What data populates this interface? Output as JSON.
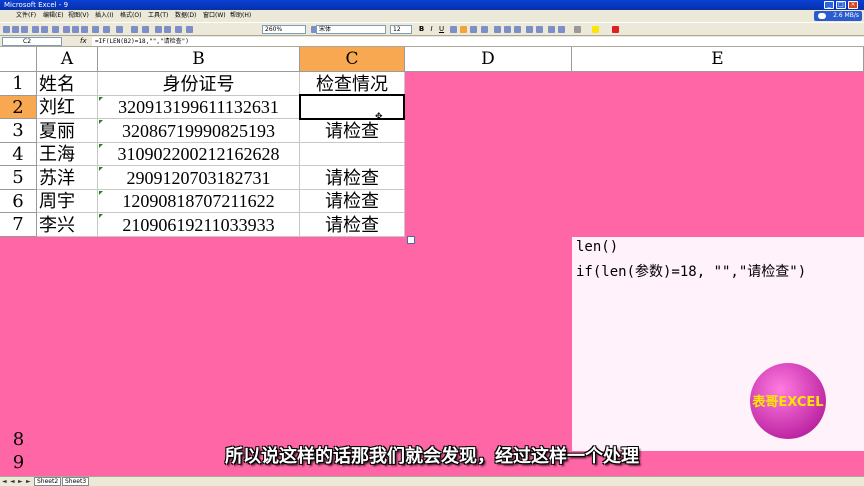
{
  "window": {
    "title": "Microsoft Excel - 9"
  },
  "menu": [
    "文件(F)",
    "编辑(E)",
    "视图(V)",
    "插入(I)",
    "格式(O)",
    "工具(T)",
    "数据(D)",
    "窗口(W)",
    "帮助(H)"
  ],
  "network": {
    "speed": "2.6 MB/s"
  },
  "toolbar": {
    "zoom": "260%",
    "font": "宋体",
    "size": "12",
    "bold": "B",
    "italic": "I",
    "underline": "U"
  },
  "formula_bar": {
    "name_box": "C2",
    "fx": "fx",
    "formula": "=IF(LEN(B2)=18,\"\",\"请检查\")"
  },
  "columns": [
    "A",
    "B",
    "C",
    "D",
    "E"
  ],
  "rows": [
    {
      "num": "1",
      "name": "姓名",
      "id": "身份证号",
      "check": "检查情况"
    },
    {
      "num": "2",
      "name": "刘红",
      "id": "320913199611132631",
      "check": ""
    },
    {
      "num": "3",
      "name": "夏丽",
      "id": "32086719990825193",
      "check": "请检查"
    },
    {
      "num": "4",
      "name": "王海",
      "id": "310902200212162628",
      "check": ""
    },
    {
      "num": "5",
      "name": "苏洋",
      "id": "2909120703182731",
      "check": "请检查"
    },
    {
      "num": "6",
      "name": "周宇",
      "id": "12090818707211622",
      "check": "请检查"
    },
    {
      "num": "7",
      "name": "李兴",
      "id": "21090619211033933",
      "check": "请检查"
    }
  ],
  "extra_rows": [
    "8",
    "9"
  ],
  "note": {
    "line1": "len()",
    "line2": "if(len(参数)=18, \"\",\"请检查\")"
  },
  "logo_text": "表哥EXCEL",
  "subtitle": "所以说这样的话那我们就会发现，经过这样一个处理",
  "sheet_tabs": [
    "Sheet2",
    "Sheet3"
  ],
  "colors": {
    "background": "#ff66a6",
    "selected_header": "#f7a850",
    "logo": "#c12aa6"
  }
}
